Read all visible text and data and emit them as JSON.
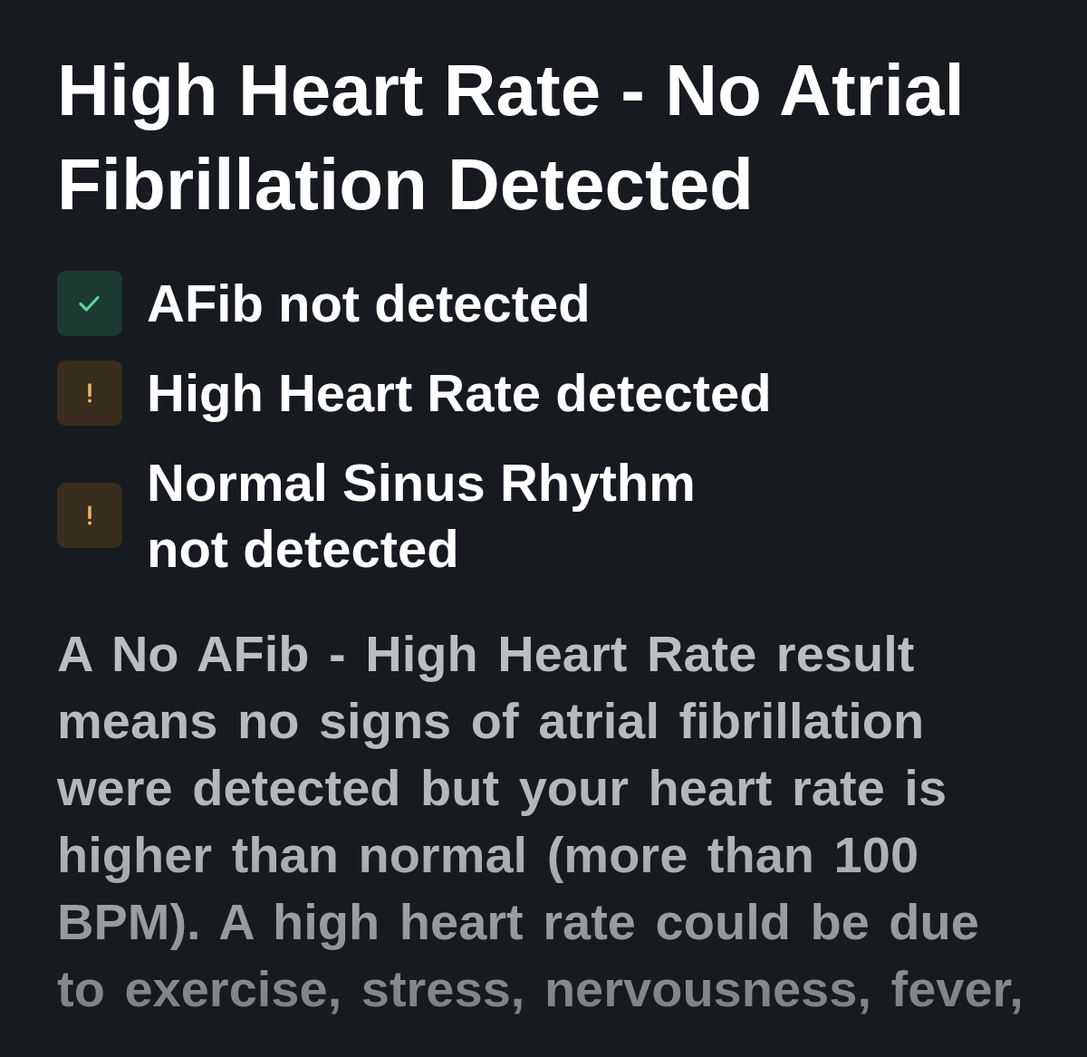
{
  "title": "High Heart Rate - No Atrial Fibrillation Detected",
  "findings": [
    {
      "kind": "check",
      "label": "AFib not detected"
    },
    {
      "kind": "warning",
      "label": "High Heart Rate detected"
    },
    {
      "kind": "warning",
      "label": "Normal Sinus Rhythm not detected"
    }
  ],
  "description": "A No AFib - High Heart Rate result means no signs of atrial fibrillation were detected but your heart rate is higher than normal (more than 100 BPM). A high heart rate could be due to exercise, stress, nervousness, fever,"
}
